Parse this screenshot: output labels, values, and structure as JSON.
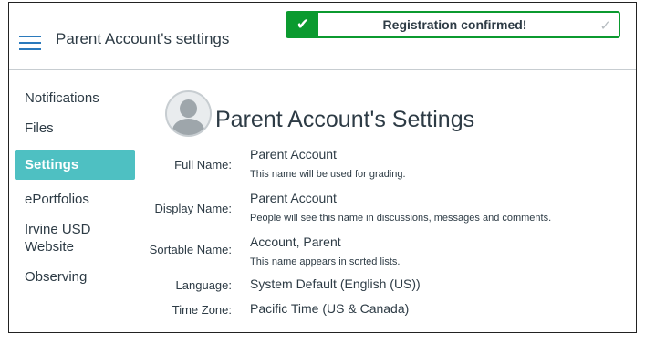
{
  "header": {
    "breadcrumb": "Parent Account's settings"
  },
  "toast": {
    "message": "Registration confirmed!",
    "check_icon": "✔",
    "close_icon": "✓"
  },
  "nav": {
    "items": [
      {
        "label": "Notifications"
      },
      {
        "label": "Files"
      },
      {
        "label": "Settings",
        "active": true
      },
      {
        "label": "ePortfolios"
      },
      {
        "label": "Irvine USD Website"
      },
      {
        "label": "Observing"
      }
    ]
  },
  "profile": {
    "title": "Parent Account's Settings",
    "fields": {
      "full_name": {
        "label": "Full Name:",
        "value": "Parent Account",
        "hint": "This name will be used for grading."
      },
      "display_name": {
        "label": "Display Name:",
        "value": "Parent Account",
        "hint": "People will see this name in discussions, messages and comments."
      },
      "sortable_name": {
        "label": "Sortable Name:",
        "value": "Account, Parent",
        "hint": "This name appears in sorted lists."
      },
      "language": {
        "label": "Language:",
        "value": "System Default (English (US))"
      },
      "time_zone": {
        "label": "Time Zone:",
        "value": "Pacific Time (US & Canada)"
      }
    }
  },
  "colors": {
    "accent": "#4ec0c2",
    "success": "#0b9a2f",
    "link": "#2b7abc"
  }
}
